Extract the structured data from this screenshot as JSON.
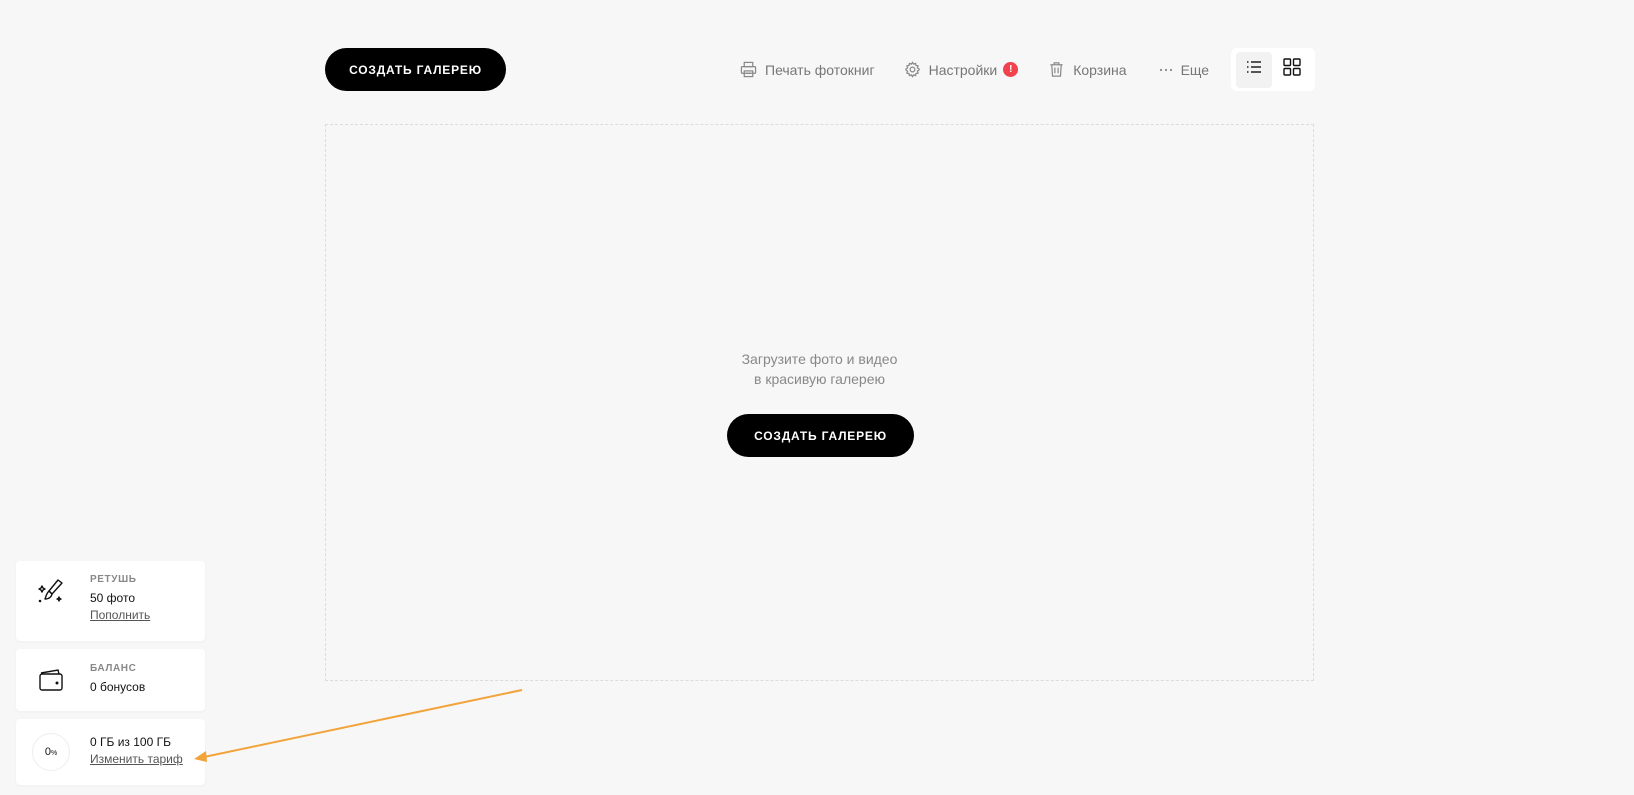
{
  "header": {
    "create_gallery_label": "СОЗДАТЬ ГАЛЕРЕЮ",
    "nav": {
      "print_label": "Печать фотокниг",
      "settings_label": "Настройки",
      "settings_badge": "!",
      "trash_label": "Корзина",
      "more_label": "Еще"
    }
  },
  "main": {
    "empty_line1": "Загрузите фото и видео",
    "empty_line2": "в красивую галерею",
    "create_gallery_label": "СОЗДАТЬ ГАЛЕРЕЮ"
  },
  "widgets": {
    "retouch": {
      "label": "РЕТУШЬ",
      "value": "50 фото",
      "link": "Пополнить"
    },
    "balance": {
      "label": "БАЛАНС",
      "value": "0 бонусов"
    },
    "storage": {
      "percent": "0",
      "percent_sign": "%",
      "value": "0 ГБ из 100 ГБ",
      "link": "Изменить тариф"
    }
  },
  "colors": {
    "accent": "#000000",
    "badge": "#f0434d",
    "annotation_arrow": "#f2a33a",
    "background": "#f7f7f7"
  }
}
